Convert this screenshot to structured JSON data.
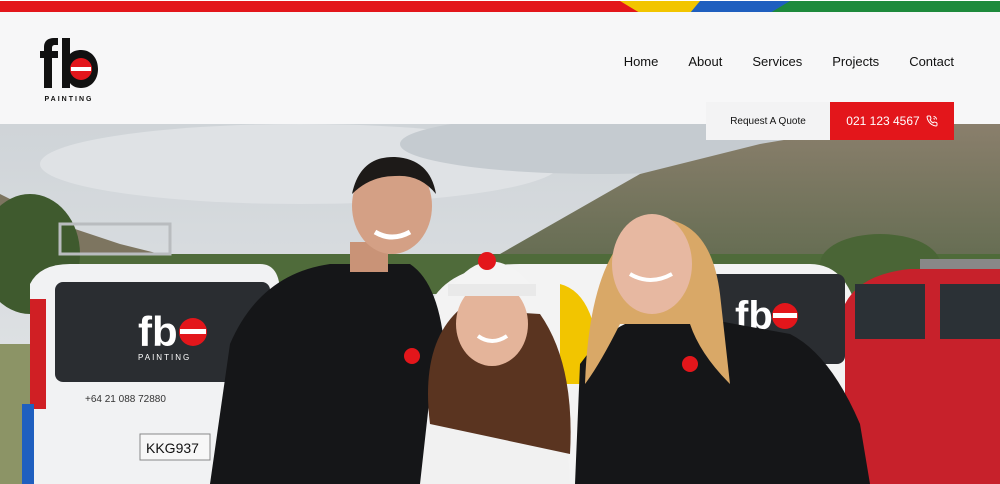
{
  "brand": {
    "logo_text": "fb",
    "logo_subtext": "PAINTING",
    "colors": {
      "red": "#e3161b",
      "yellow": "#f2c500",
      "blue": "#1f5fbf",
      "green": "#1e8a3c",
      "black": "#111111"
    }
  },
  "nav": {
    "items": [
      {
        "label": "Home"
      },
      {
        "label": "About"
      },
      {
        "label": "Services"
      },
      {
        "label": "Projects"
      },
      {
        "label": "Contact"
      }
    ]
  },
  "cta": {
    "quote_label": "Request A Quote",
    "phone_label": "021 123 4567",
    "phone_icon": "phone-icon"
  },
  "hero": {
    "van_phone": "+64 21 088 72880",
    "plate_left": "KKG937"
  }
}
